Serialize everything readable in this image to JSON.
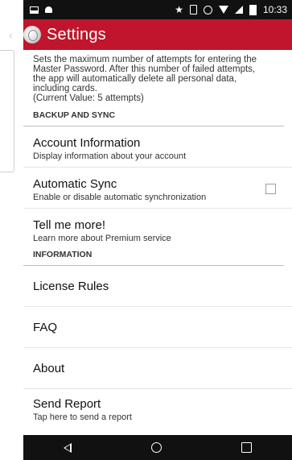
{
  "status_bar": {
    "time": "10:33",
    "icons": [
      "screenshot-icon",
      "android-icon",
      "star-icon",
      "vibrate-icon",
      "alarm-icon",
      "wifi-icon",
      "signal-icon",
      "battery-icon"
    ]
  },
  "app_bar": {
    "title": "Settings",
    "accent_color": "#c0152c"
  },
  "description": {
    "lines": [
      "Sets the maximum number of attempts for entering the",
      "Master Password. After this number of failed attempts,",
      "the app will automatically delete all personal data,",
      "including cards.",
      "(Current Value: 5 attempts)"
    ]
  },
  "sections": {
    "backup": {
      "header": "BACKUP AND SYNC",
      "account": {
        "title": "Account Information",
        "summary": "Display information about your account"
      },
      "sync": {
        "title": "Automatic Sync",
        "summary": "Enable or disable automatic synchronization",
        "checked": false
      },
      "more": {
        "title": "Tell me more!",
        "summary": "Learn more about Premium service"
      }
    },
    "info": {
      "header": "INFORMATION",
      "license": {
        "title": "License Rules"
      },
      "faq": {
        "title": "FAQ"
      },
      "about": {
        "title": "About"
      },
      "report": {
        "title": "Send Report",
        "summary": "Tap here to send a report"
      }
    }
  },
  "nav_bar": {
    "icons": [
      "nav-back-icon",
      "nav-home-icon",
      "nav-recents-icon"
    ]
  }
}
